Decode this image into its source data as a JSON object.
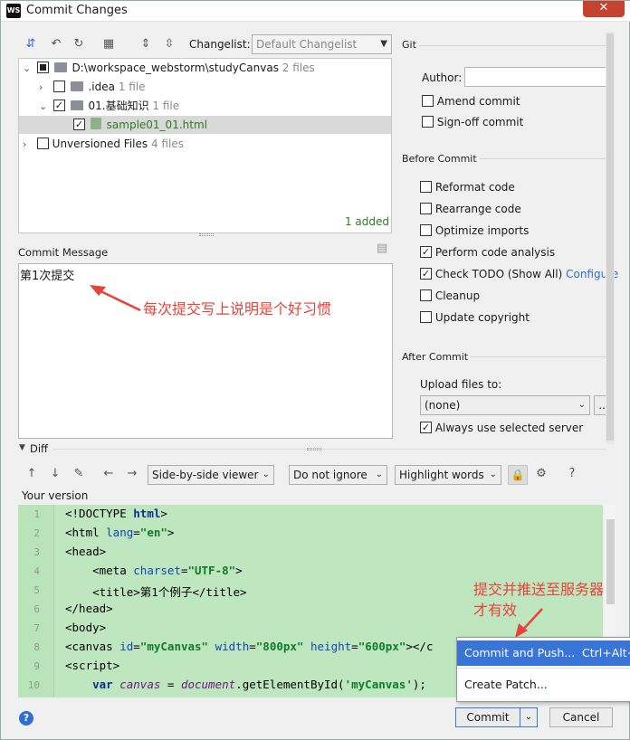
{
  "window": {
    "logo": "WS",
    "title": "Commit Changes",
    "close": "✕"
  },
  "toolbar": {
    "changelist_label": "Changelist:",
    "changelist_value": "Default Changelist"
  },
  "tree": {
    "root": {
      "label": "D:\\workspace_webstorm\\studyCanvas",
      "count": "2 files"
    },
    "idea": {
      "label": ".idea",
      "count": "1 file"
    },
    "folder01": {
      "label": "01.基础知识",
      "count": "1 file"
    },
    "file": {
      "label": "sample01_01.html"
    },
    "unversioned": {
      "label": "Unversioned Files",
      "count": "4 files"
    },
    "status": "1 added"
  },
  "commit_message": {
    "label": "Commit Message",
    "text": "第1次提交",
    "annotation": "每次提交写上说明是个好习惯"
  },
  "git": {
    "section": "Git",
    "author_label": "Author:",
    "author_value": "",
    "amend": "Amend commit",
    "signoff": "Sign-off commit"
  },
  "before_commit": {
    "section": "Before Commit",
    "reformat": "Reformat code",
    "rearrange": "Rearrange code",
    "optimize": "Optimize imports",
    "analysis": "Perform code analysis",
    "todo": "Check TODO (Show All)",
    "configure": "Configure",
    "cleanup": "Cleanup",
    "copyright": "Update copyright"
  },
  "after_commit": {
    "section": "After Commit",
    "upload_label": "Upload files to:",
    "upload_value": "(none)",
    "more": "...",
    "always": "Always use selected server"
  },
  "diff": {
    "label": "Diff",
    "viewer": "Side-by-side viewer",
    "ignore": "Do not ignore",
    "highlight": "Highlight words",
    "your_version": "Your version",
    "annotation_line1": "提交并推送至服务器",
    "annotation_line2": "才有效"
  },
  "code_lines": [
    {
      "n": "1"
    },
    {
      "n": "2"
    },
    {
      "n": "3"
    },
    {
      "n": "4"
    },
    {
      "n": "5"
    },
    {
      "n": "6"
    },
    {
      "n": "7"
    },
    {
      "n": "8"
    },
    {
      "n": "9"
    },
    {
      "n": "10"
    }
  ],
  "code_text": {
    "l1a": "<!DOCTYPE ",
    "l1b": "html",
    "l1c": ">",
    "l2a": "<html ",
    "l2b": "lang",
    "l2c": "=",
    "l2d": "\"en\"",
    "l2e": ">",
    "l3": "<head>",
    "l4a": "    <meta ",
    "l4b": "charset",
    "l4c": "=",
    "l4d": "\"UTF-8\"",
    "l4e": ">",
    "l5a": "    <title>",
    "l5b": "第1个例子",
    "l5c": "</title>",
    "l6": "</head>",
    "l7": "<body>",
    "l8a": "<canvas ",
    "l8b": "id",
    "l8c": "=",
    "l8d": "\"myCanvas\"",
    "l8e": " ",
    "l8f": "width",
    "l8g": "=",
    "l8h": "\"800px\"",
    "l8i": " ",
    "l8j": "height",
    "l8k": "=",
    "l8l": "\"600px\"",
    "l8m": "></c",
    "l9": "<script>",
    "l10a": "    var ",
    "l10b": "canvas",
    "l10c": " = ",
    "l10d": "document",
    "l10e": ".getElementById(",
    "l10f": "'myCanvas'",
    "l10g": ");"
  },
  "popup": {
    "commit_push": "Commit and Push...",
    "shortcut": "Ctrl+Alt+K",
    "create_patch": "Create Patch..."
  },
  "footer": {
    "help": "?",
    "commit": "Commit",
    "cancel": "Cancel"
  },
  "colors": {
    "accent": "#3875d7",
    "added_green": "#2c7a24",
    "annotation_red": "#e8433a",
    "diff_bg": "#bee6bf"
  }
}
